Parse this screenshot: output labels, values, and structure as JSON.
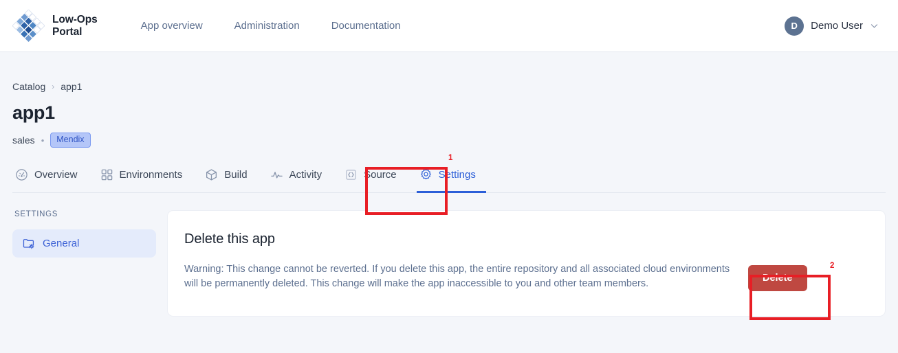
{
  "header": {
    "brand": {
      "line1": "Low-Ops",
      "line2": "Portal",
      "logo_icon": "diamond-grid-logo"
    },
    "nav": [
      {
        "label": "App overview",
        "name": "nav-link-app-overview"
      },
      {
        "label": "Administration",
        "name": "nav-link-administration"
      },
      {
        "label": "Documentation",
        "name": "nav-link-documentation"
      }
    ],
    "user": {
      "initial": "D",
      "name": "Demo User",
      "chevron_icon": "chevron-down-icon"
    }
  },
  "breadcrumb": {
    "root": "Catalog",
    "separator": "›",
    "current": "app1"
  },
  "page": {
    "title": "app1",
    "owner": "sales",
    "dot": "•",
    "badge": "Mendix"
  },
  "tabs": [
    {
      "label": "Overview",
      "icon": "gauge-icon",
      "active": false
    },
    {
      "label": "Environments",
      "icon": "grid-icon",
      "active": false
    },
    {
      "label": "Build",
      "icon": "package-box-icon",
      "active": false
    },
    {
      "label": "Activity",
      "icon": "pulse-icon",
      "active": false
    },
    {
      "label": "Source",
      "icon": "code-braces-icon",
      "active": false
    },
    {
      "label": "Settings",
      "icon": "gear-icon",
      "active": true
    }
  ],
  "sidebar": {
    "heading": "SETTINGS",
    "items": [
      {
        "label": "General",
        "icon": "folder-gear-icon",
        "active": true
      }
    ]
  },
  "card": {
    "title": "Delete this app",
    "warning": "Warning: This change cannot be reverted. If you delete this app, the entire repository and all associated cloud environments will be permanently deleted. This change will make the app inaccessible to you and other team members.",
    "delete_label": "Delete"
  },
  "annotations": [
    {
      "id": "1",
      "label": "1",
      "target": "settings-tab"
    },
    {
      "id": "2",
      "label": "2",
      "target": "delete-button"
    }
  ],
  "colors": {
    "page_bg": "#f4f6fa",
    "header_bg": "#ffffff",
    "accent_blue": "#2c5fd8",
    "danger_red": "#bf4841",
    "annotation_red": "#e81e25",
    "badge_bg": "#b4c6f8",
    "sidebar_active_bg": "#e4ebfb"
  }
}
